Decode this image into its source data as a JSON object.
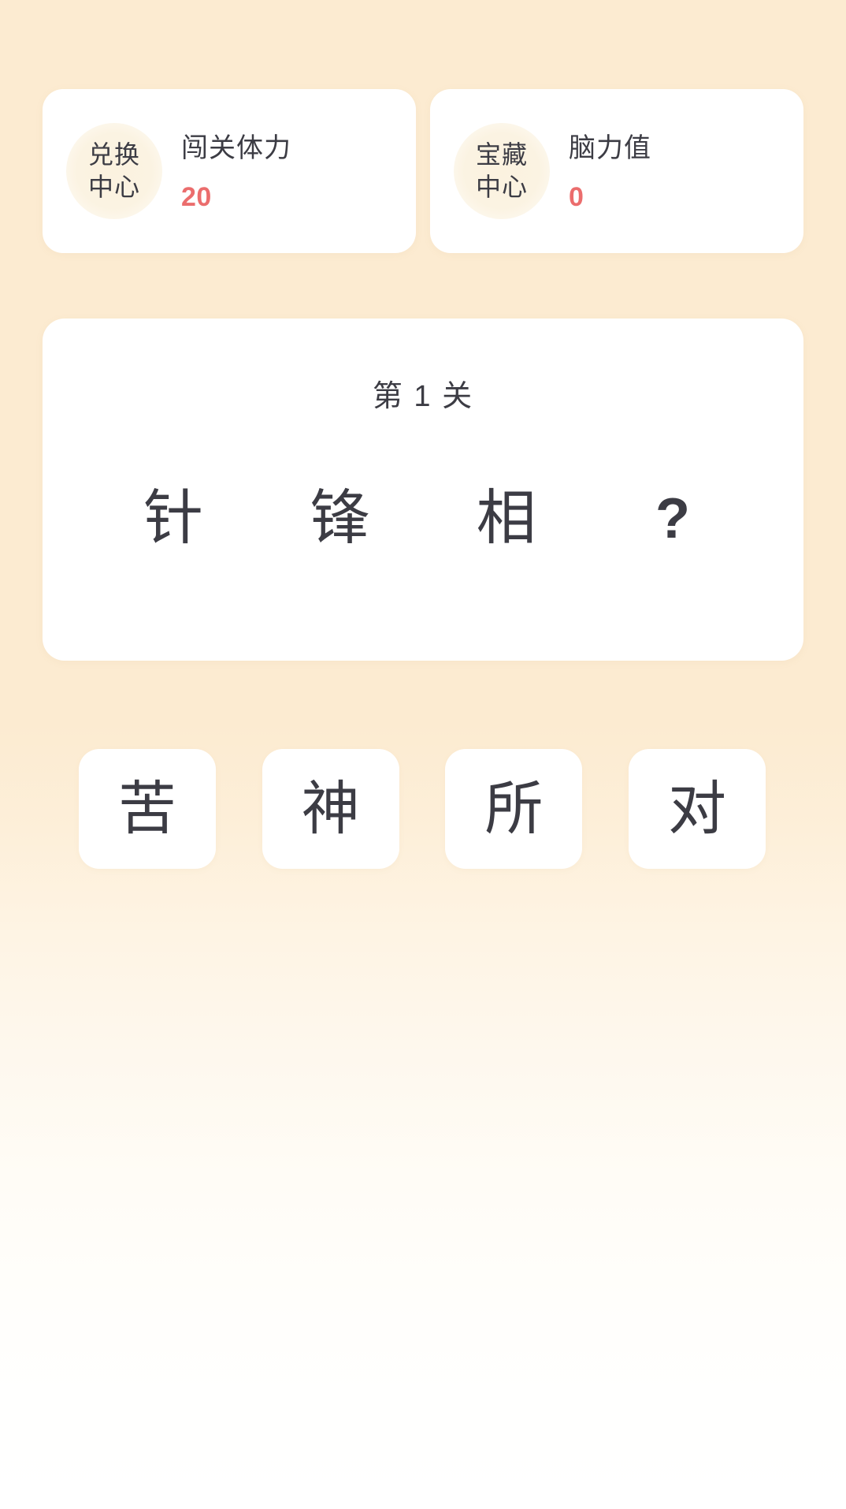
{
  "theme": {
    "background_top": "#FCEBD1",
    "background_bottom": "#FFFFFF",
    "card_background": "#FFFFFF",
    "text_color": "#3C3C44",
    "accent_value_color": "#EB6D6D",
    "badge_color": "#FBF2DF"
  },
  "stats": [
    {
      "badge_line1": "兑换",
      "badge_line2": "中心",
      "badge_name": "exchange-center",
      "label": "闯关体力",
      "value": "20"
    },
    {
      "badge_line1": "宝藏",
      "badge_line2": "中心",
      "badge_name": "treasure-center",
      "label": "脑力值",
      "value": "0"
    }
  ],
  "puzzle": {
    "level_title": "第 1 关",
    "chars": [
      "针",
      "锋",
      "相",
      "?"
    ]
  },
  "answers": [
    {
      "char": "苦"
    },
    {
      "char": "神"
    },
    {
      "char": "所"
    },
    {
      "char": "对"
    }
  ]
}
